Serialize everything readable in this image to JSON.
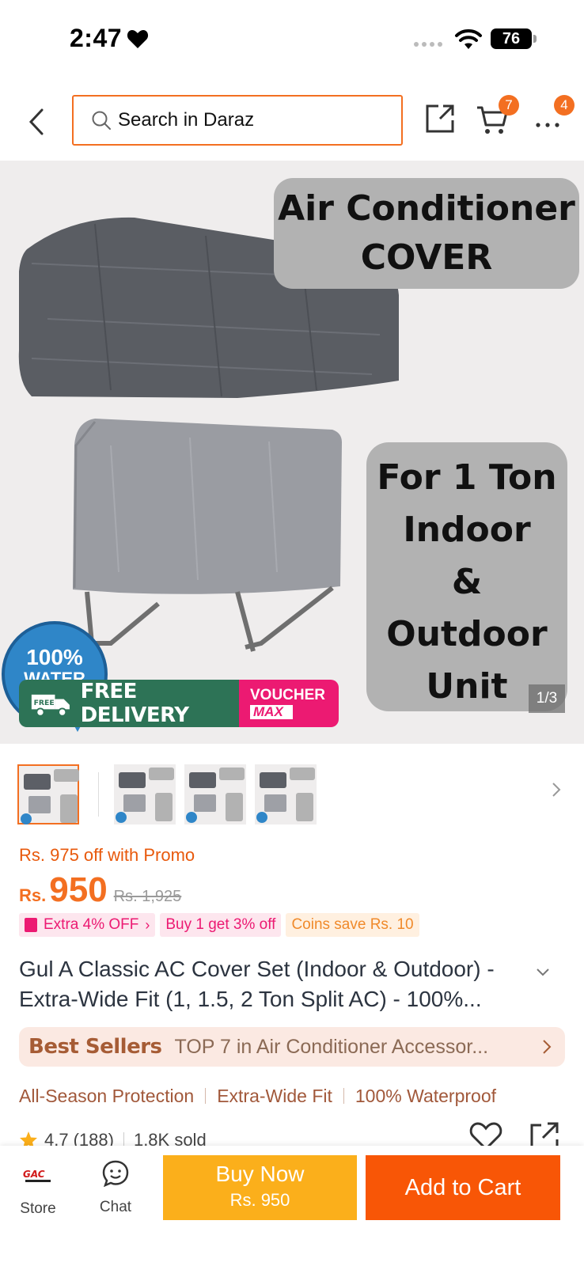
{
  "status_bar": {
    "time": "2:47",
    "battery": "76"
  },
  "header": {
    "search_placeholder": "Search in Daraz",
    "cart_count": "7",
    "more_count": "4"
  },
  "gallery": {
    "overlay_title_line1": "Air Conditioner",
    "overlay_title_line2": "COVER",
    "overlay_spec_lines": [
      "For 1 Ton",
      "Indoor",
      "&",
      "Outdoor",
      "Unit"
    ],
    "seal_percent": "100%",
    "seal_text": "WATER",
    "free_tag": "FREE",
    "delivery_text": "FREE DELIVERY",
    "voucher_top": "VOUCHER",
    "voucher_bottom": "MAX",
    "counter": "1/3"
  },
  "pricing": {
    "promo_line": "Rs. 975 off with Promo",
    "currency": "Rs.",
    "price": "950",
    "old_price": "Rs. 1,925",
    "tags": [
      "Extra 4% OFF",
      "Buy 1 get 3% off",
      "Coins save Rs. 10"
    ]
  },
  "product": {
    "title": "Gul A Classic AC Cover Set (Indoor & Outdoor) - Extra-Wide Fit (1, 1.5, 2 Ton Split AC) - 100%..."
  },
  "best_sellers": {
    "label": "Best Sellers",
    "rank_text": "TOP 7 in Air Conditioner Accessor..."
  },
  "features": [
    "All-Season Protection",
    "Extra-Wide Fit",
    "100% Waterproof"
  ],
  "rating": {
    "score": "4.7",
    "count": "(188)",
    "sold": "1.8K sold"
  },
  "bottom_bar": {
    "store_label": "Store",
    "store_logo_text": "GAC",
    "chat_label": "Chat",
    "buy_now_label": "Buy Now",
    "buy_now_price": "Rs. 950",
    "add_to_cart_label": "Add to Cart"
  },
  "colors": {
    "accent": "#f36f21",
    "buy_now": "#fbaf1b",
    "add_to_cart": "#f85606",
    "promo_pink": "#ec1a72"
  }
}
